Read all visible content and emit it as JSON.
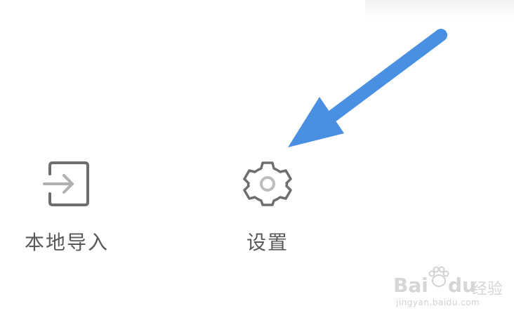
{
  "tools": {
    "local_import": {
      "label": "本地导入",
      "icon": "import-icon"
    },
    "settings": {
      "label": "设置",
      "icon": "gear-icon"
    }
  },
  "annotation": {
    "arrow_color": "#4a90e2"
  },
  "watermark": {
    "brand_latin": "Bai",
    "brand_du": "du",
    "brand_suffix": "经验",
    "url": "jingyan.baidu.com"
  },
  "colors": {
    "icon_stroke": "#6e6e6e",
    "icon_inner": "#bdbdbd",
    "label_text": "#595959",
    "arrow": "#4a90e2"
  }
}
